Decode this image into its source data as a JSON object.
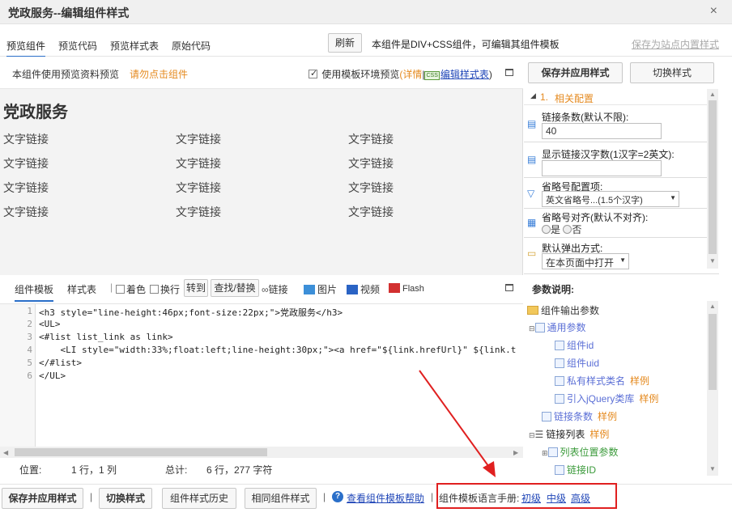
{
  "window": {
    "title": "党政服务--编辑组件样式",
    "close_glyph": "×"
  },
  "tabs": [
    {
      "label": "预览组件",
      "active": true
    },
    {
      "label": "预览代码",
      "active": false
    },
    {
      "label": "预览样式表",
      "active": false
    },
    {
      "label": "原始代码",
      "active": false
    }
  ],
  "top": {
    "refresh_label": "刷新",
    "info": "本组件是DIV+CSS组件，可编辑其组件模板",
    "save_site_style": "保存为站点内置样式"
  },
  "preview_bar": {
    "text": "本组件使用预览资料预览",
    "hint": "请勿点击组件",
    "use_template_env": "使用模板环境预览",
    "details_paren": "(详情",
    "details_sep": "|",
    "css_badge": "CSS",
    "edit_stylesheet": "编辑样式表",
    "details_close": ")"
  },
  "preview": {
    "title": "党政服务",
    "links": [
      [
        "文字链接",
        "文字链接",
        "文字链接"
      ],
      [
        "文字链接",
        "文字链接",
        "文字链接"
      ],
      [
        "文字链接",
        "文字链接",
        "文字链接"
      ],
      [
        "文字链接",
        "文字链接",
        "文字链接"
      ]
    ]
  },
  "right": {
    "save_apply": "保存并应用样式",
    "switch_style": "切换样式",
    "section_num": "1.",
    "section_title": "相关配置",
    "rows": [
      {
        "label": "链接条数(默认不限):",
        "value": "40"
      },
      {
        "label": "显示链接汉字数(1汉字=2英文):",
        "value": ""
      },
      {
        "label": "省略号配置项:",
        "value": "英文省略号...(1.5个汉字)"
      },
      {
        "label": "省略号对齐(默认不对齐):",
        "opt_yes": "是",
        "opt_no": "否"
      },
      {
        "label": "默认弹出方式:",
        "value": "在本页面中打开"
      }
    ],
    "params_title": "参数说明:",
    "tree": [
      {
        "text": "组件输出参数"
      },
      {
        "text": "通用参数"
      },
      {
        "text": "组件id"
      },
      {
        "text": "组件uid"
      },
      {
        "text": "私有样式类名",
        "sample": "样例"
      },
      {
        "text": "引入jQuery类库",
        "sample": "样例"
      },
      {
        "text": "链接条数",
        "sample": "样例"
      },
      {
        "text": "链接列表",
        "sample": "样例"
      },
      {
        "text": "列表位置参数"
      },
      {
        "text": "链接ID"
      }
    ]
  },
  "editor_toolbar": {
    "tab_template": "组件模板",
    "tab_stylesheet": "样式表",
    "color": "着色",
    "wrap": "换行",
    "goto": "转到",
    "find_replace": "查找/替换",
    "link": "链接",
    "image": "图片",
    "video": "视频",
    "flash": "Flash"
  },
  "code_lines": [
    "<h3 style=\"line-height:46px;font-size:22px;\">党政服务</h3>",
    "<UL>",
    "<#list list_link as link>",
    "    <LI style=\"width:33%;float:left;line-height:30px;\"><a href=\"${link.hrefUrl}\" ${link.t",
    "</#list>",
    "</UL>"
  ],
  "status": {
    "pos_label": "位置:",
    "pos_value": "1 行，1 列",
    "total_label": "总计:",
    "total_value": "6 行，277 字符"
  },
  "bottom": {
    "save_apply": "保存并应用样式",
    "switch_style": "切换样式",
    "history": "组件样式历史",
    "same": "相同组件样式",
    "help": "查看组件模板帮助",
    "manual_label": "组件模板语言手册:",
    "basic": "初级",
    "middle": "中级",
    "advanced": "高级"
  },
  "colors": {
    "accent_orange": "#e58a1f",
    "link_blue": "#2147b8",
    "highlight_red": "#e02020"
  }
}
